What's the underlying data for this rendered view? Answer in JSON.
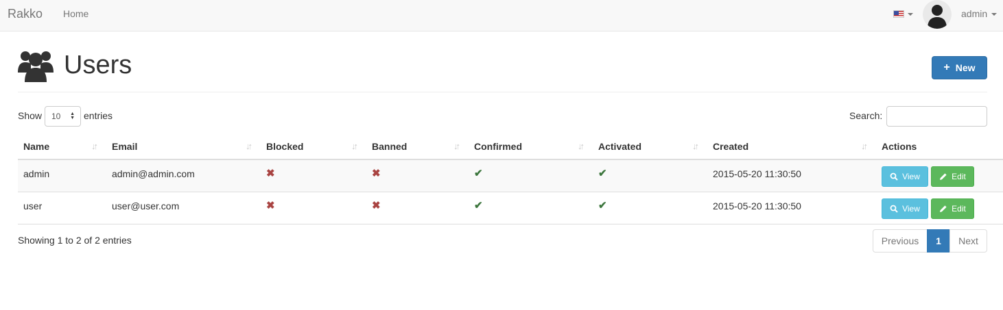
{
  "navbar": {
    "brand": "Rakko",
    "home": "Home",
    "language_icon": "us-flag-icon",
    "user_icon": "user-avatar-icon",
    "user_name": "admin"
  },
  "header": {
    "icon": "users-icon",
    "title": "Users",
    "new_button": "New",
    "new_icon": "plus-icon"
  },
  "controls": {
    "show_label": "Show",
    "length_value": "10",
    "entries_label": "entries",
    "search_label": "Search:",
    "search_value": ""
  },
  "table": {
    "columns": [
      "Name",
      "Email",
      "Blocked",
      "Banned",
      "Confirmed",
      "Activated",
      "Created",
      "Actions"
    ],
    "rows": [
      {
        "name": "admin",
        "email": "admin@admin.com",
        "blocked": "✖",
        "banned": "✖",
        "confirmed": "✔",
        "activated": "✔",
        "created": "2015-05-20 11:30:50",
        "view": "View",
        "edit": "Edit"
      },
      {
        "name": "user",
        "email": "user@user.com",
        "blocked": "✖",
        "banned": "✖",
        "confirmed": "✔",
        "activated": "✔",
        "created": "2015-05-20 11:30:50",
        "view": "View",
        "edit": "Edit"
      }
    ]
  },
  "footer": {
    "info": "Showing 1 to 2 of 2 entries",
    "previous": "Previous",
    "current_page": "1",
    "next": "Next"
  },
  "colors": {
    "primary": "#337ab7",
    "info": "#5bc0de",
    "success": "#5cb85c",
    "danger": "#a94442",
    "ok": "#3c763d"
  }
}
